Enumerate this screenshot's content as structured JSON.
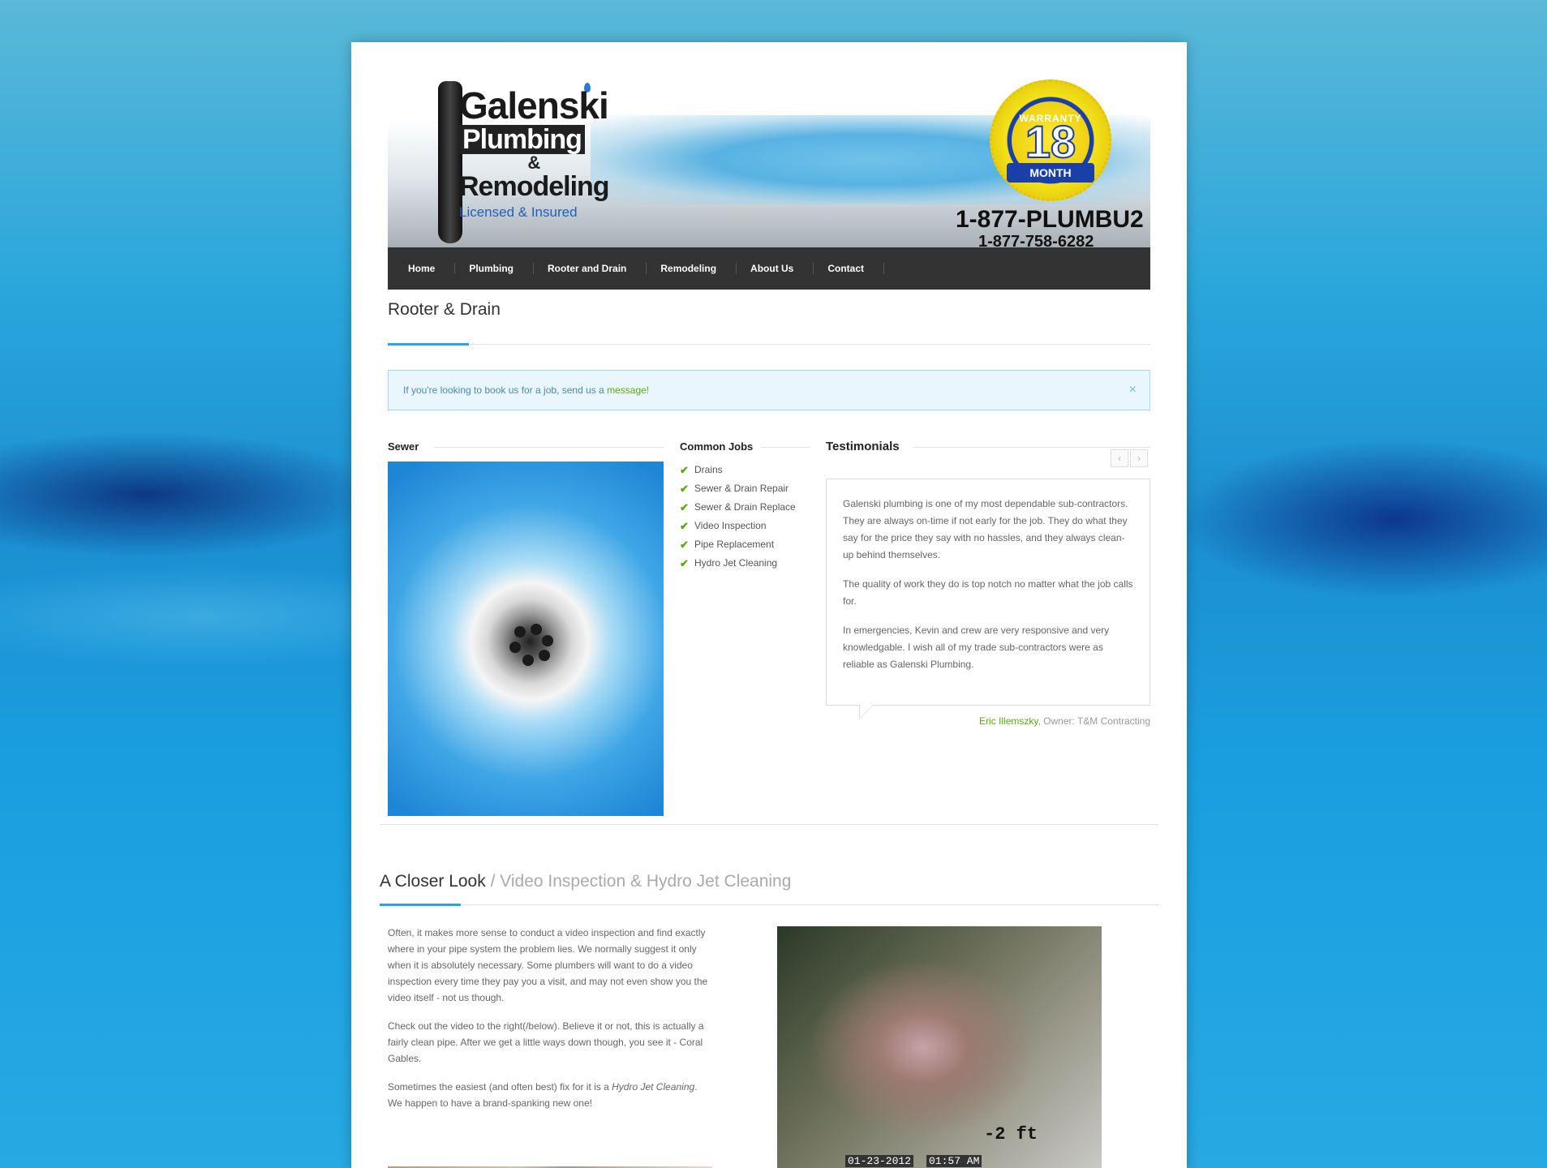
{
  "header": {
    "logo_line1": "Galenski",
    "logo_line2": "Plumbing",
    "logo_amp": "&",
    "logo_line3": "Remodeling",
    "logo_tagline": "Licensed & Insured",
    "badge_top": "WARRANTY",
    "badge_number": "18",
    "badge_bottom": "MONTH",
    "phone_vanity": "1-877-PLUMBU2",
    "phone_number": "1-877-758-6282"
  },
  "nav": {
    "items": [
      "Home",
      "Plumbing",
      "Rooter and Drain",
      "Remodeling",
      "About Us",
      "Contact"
    ]
  },
  "page": {
    "title": "Rooter & Drain"
  },
  "alert": {
    "text": "If you're looking to book us for a job, send us a ",
    "link": "message!",
    "close": "×"
  },
  "sewer": {
    "heading": "Sewer"
  },
  "common_jobs": {
    "heading": "Common Jobs",
    "items": [
      "Drains",
      "Sewer & Drain Repair",
      "Sewer & Drain Replace",
      "Video Inspection",
      "Pipe Replacement",
      "Hydro Jet Cleaning"
    ]
  },
  "testimonials": {
    "heading": "Testimonials",
    "prev": "‹",
    "next": "›",
    "paragraphs": [
      "Galenski plumbing is one of my most dependable sub-contractors. They are always on-time if not early for the job. They do what they say for the price they say with no hassles, and they always clean-up behind themselves.",
      "The quality of work they do is top notch no matter what the job calls for.",
      "In emergencies, Kevin and crew are very responsive and very knowledgable. I wish all of my trade sub-contractors were as reliable as Galenski Plumbing."
    ],
    "author_name": "Eric Illemszky",
    "author_role": ", Owner: T&M Contracting"
  },
  "closer_look": {
    "title": "A Closer Look",
    "subtitle": " / Video Inspection & Hydro Jet Cleaning",
    "p1": "Often, it makes more sense to conduct a video inspection and find exactly where in your pipe system the problem lies. We normally suggest it only when it is absolutely necessary. Some plumbers will want to do a video inspection every time they pay you a visit, and may not even show you the video itself - not us though.",
    "p2": "Check out the video to the right(/below). Believe it or not, this is actually a fairly clean pipe. After we get a little ways down though, you see it - Coral Gables.",
    "p3_pre": "Sometimes the easiest (and often best) fix for it is a ",
    "p3_em": "Hydro Jet Cleaning",
    "p3_post": ". We happen to have a brand-spanking new one!",
    "video_distance": "-2 ft",
    "video_date": "01-23-2012",
    "video_time": "01:57 AM"
  }
}
